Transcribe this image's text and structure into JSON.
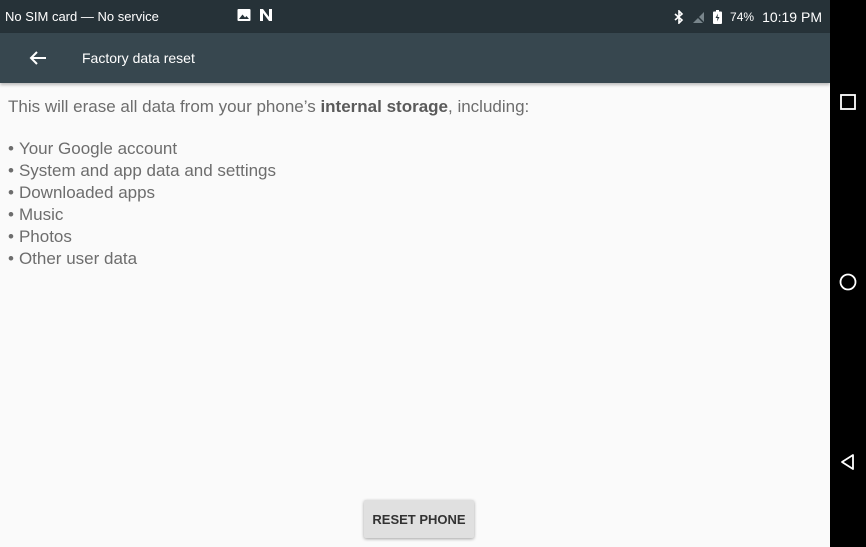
{
  "status_bar": {
    "carrier_text": "No SIM card — No service",
    "battery_percent": "74%",
    "time": "10:19 PM",
    "icons": [
      "image-notification-icon",
      "n-notification-icon",
      "bluetooth-icon",
      "no-signal-icon",
      "battery-icon"
    ]
  },
  "toolbar": {
    "title": "Factory data reset",
    "back_icon": "arrow-back-icon"
  },
  "content": {
    "intro_prefix": "This will erase all data from your phone’s ",
    "intro_bold": "internal storage",
    "intro_suffix": ", including:",
    "items": [
      "Your Google account",
      "System and app data and settings",
      "Downloaded apps",
      "Music",
      "Photos",
      "Other user data"
    ]
  },
  "actions": {
    "reset_label": "RESET PHONE"
  },
  "nav_bar": {
    "icons": [
      "recents-icon",
      "home-icon",
      "back-icon"
    ]
  },
  "colors": {
    "status_bar": "#263238",
    "toolbar": "#37474f",
    "background": "#fafafa",
    "button": "#e0e0e0"
  }
}
